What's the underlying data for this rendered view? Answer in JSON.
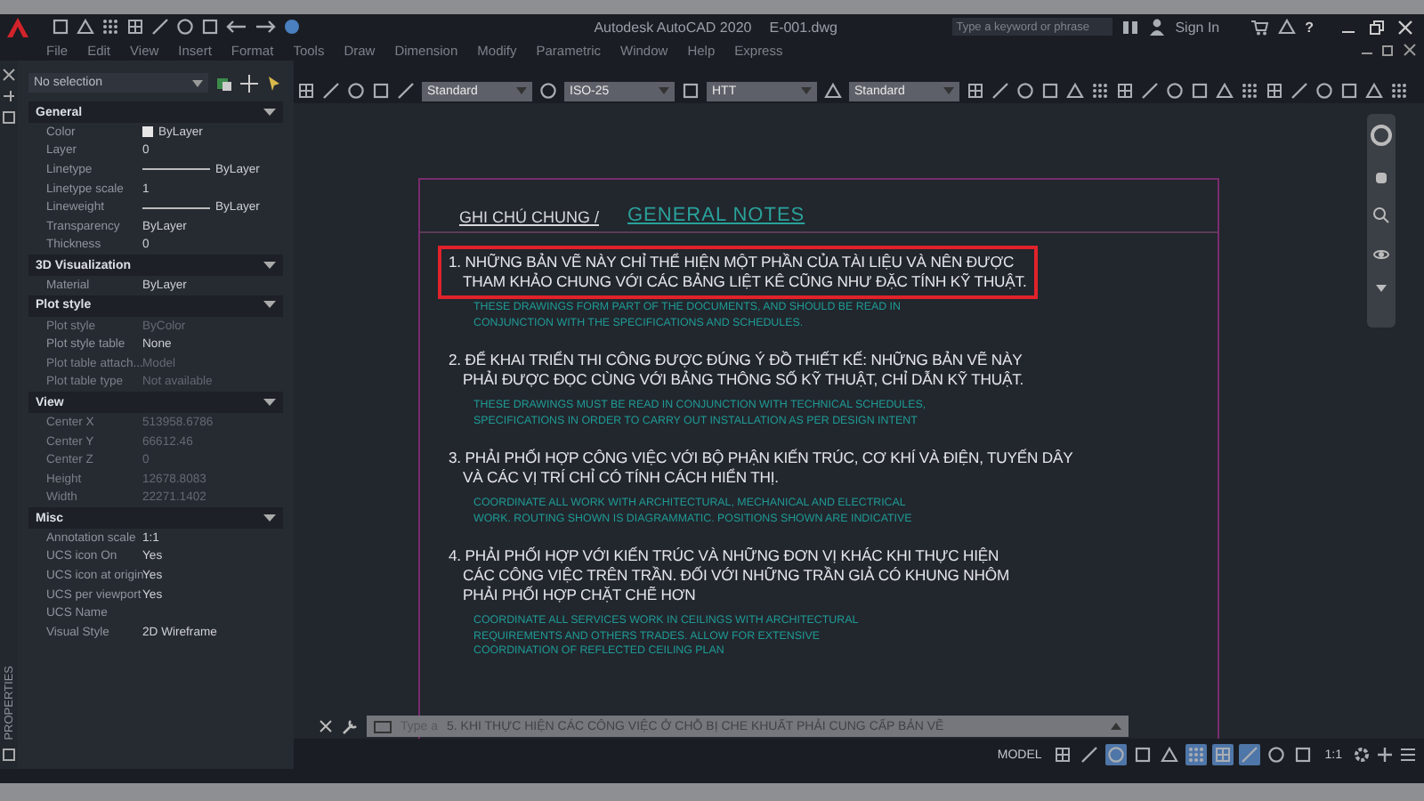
{
  "app": {
    "title": "Autodesk AutoCAD 2020",
    "file": "E-001.dwg",
    "search_placeholder": "Type a keyword or phrase",
    "sign_in": "Sign In",
    "help": "?"
  },
  "menu": [
    "File",
    "Edit",
    "View",
    "Insert",
    "Format",
    "Tools",
    "Draw",
    "Dimension",
    "Modify",
    "Parametric",
    "Window",
    "Help",
    "Express"
  ],
  "toolbar": {
    "dropdowns": [
      "Standard",
      "ISO-25",
      "HTT",
      "Standard"
    ]
  },
  "properties": {
    "selection": "No selection",
    "tab_label": "PROPERTIES",
    "sections": [
      {
        "title": "General",
        "expanded": true,
        "rows": [
          {
            "label": "Color",
            "value": "ByLayer",
            "kind": "swatch",
            "disabled": false
          },
          {
            "label": "Layer",
            "value": "0",
            "kind": "text",
            "disabled": false
          },
          {
            "label": "Linetype",
            "value": "ByLayer",
            "kind": "line",
            "disabled": false
          },
          {
            "label": "Linetype scale",
            "value": "1",
            "kind": "text",
            "disabled": false
          },
          {
            "label": "Lineweight",
            "value": "ByLayer",
            "kind": "line",
            "disabled": false
          },
          {
            "label": "Transparency",
            "value": "ByLayer",
            "kind": "text",
            "disabled": false
          },
          {
            "label": "Thickness",
            "value": "0",
            "kind": "text",
            "disabled": false
          }
        ]
      },
      {
        "title": "3D Visualization",
        "expanded": true,
        "rows": [
          {
            "label": "Material",
            "value": "ByLayer",
            "kind": "text",
            "disabled": false
          }
        ]
      },
      {
        "title": "Plot style",
        "expanded": true,
        "rows": [
          {
            "label": "Plot style",
            "value": "ByColor",
            "kind": "text",
            "disabled": true
          },
          {
            "label": "Plot style table",
            "value": "None",
            "kind": "text",
            "disabled": false
          },
          {
            "label": "Plot table attach...",
            "value": "Model",
            "kind": "text",
            "disabled": true
          },
          {
            "label": "Plot table type",
            "value": "Not available",
            "kind": "text",
            "disabled": true
          }
        ]
      },
      {
        "title": "View",
        "expanded": true,
        "rows": [
          {
            "label": "Center X",
            "value": "513958.6786",
            "kind": "text",
            "disabled": true
          },
          {
            "label": "Center Y",
            "value": "66612.46",
            "kind": "text",
            "disabled": true
          },
          {
            "label": "Center Z",
            "value": "0",
            "kind": "text",
            "disabled": true
          },
          {
            "label": "Height",
            "value": "12678.8083",
            "kind": "text",
            "disabled": true
          },
          {
            "label": "Width",
            "value": "22271.1402",
            "kind": "text",
            "disabled": true
          }
        ]
      },
      {
        "title": "Misc",
        "expanded": true,
        "rows": [
          {
            "label": "Annotation scale",
            "value": "1:1",
            "kind": "text",
            "disabled": false
          },
          {
            "label": "UCS icon On",
            "value": "Yes",
            "kind": "text",
            "disabled": false
          },
          {
            "label": "UCS icon at origin",
            "value": "Yes",
            "kind": "text",
            "disabled": false
          },
          {
            "label": "UCS per viewport",
            "value": "Yes",
            "kind": "text",
            "disabled": false
          },
          {
            "label": "UCS Name",
            "value": "",
            "kind": "text",
            "disabled": false
          },
          {
            "label": "Visual Style",
            "value": "2D Wireframe",
            "kind": "text",
            "disabled": false
          }
        ]
      }
    ]
  },
  "drawing": {
    "heading": "GHI CHÚ CHUNG /",
    "heading_en": "GENERAL NOTES",
    "notes": [
      {
        "highlighted": true,
        "lines_vi": [
          "1. NHỮNG BẢN VẼ NÀY CHỈ THỂ HIỆN MỘT PHẦN CỦA TÀI  LIỆU VÀ NÊN ĐƯỢC",
          "THAM KHẢO CHUNG VỚI CÁC BẢNG LIỆT KÊ CŨNG NHƯ ĐẶC TÍNH KỸ THUẬT."
        ],
        "lines_en": [
          "THESE DRAWINGS FORM PART OF THE DOCUMENTS, AND SHOULD BE READ IN",
          "CONJUNCTION WITH THE SPECIFICATIONS AND SCHEDULES."
        ]
      },
      {
        "highlighted": false,
        "lines_vi": [
          "2. ĐỂ KHAI TRIỂN THI CÔNG ĐƯỢC ĐÚNG Ý ĐỒ THIẾT KẾ: NHỮNG BẢN VẼ NÀY",
          "PHẢI ĐƯỢC ĐỌC CÙNG VỚI BẢNG THÔNG SỐ KỸ THUẬT, CHỈ DẪN KỸ THUẬT."
        ],
        "lines_en": [
          "THESE DRAWINGS MUST BE READ IN CONJUNCTION WITH TECHNICAL SCHEDULES,",
          "SPECIFICATIONS IN ORDER TO CARRY OUT INSTALLATION AS PER DESIGN INTENT"
        ]
      },
      {
        "highlighted": false,
        "lines_vi": [
          "3. PHẢI PHỐI HỢP CÔNG VIỆC VỚI BỘ PHẬN KIẾN TRÚC, CƠ KHÍ VÀ ĐIỆN, TUYẾN DÂY",
          "VÀ CÁC VỊ TRÍ CHỈ CÓ TÍNH CÁCH HIỂN THỊ."
        ],
        "lines_en": [
          "COORDINATE ALL WORK WITH ARCHITECTURAL, MECHANICAL AND ELECTRICAL",
          "WORK. ROUTING SHOWN IS DIAGRAMMATIC. POSITIONS SHOWN ARE INDICATIVE"
        ]
      },
      {
        "highlighted": false,
        "lines_vi": [
          "4. PHẢI PHỐI HỢP VỚI KIẾN TRÚC VÀ NHỮNG ĐƠN VỊ KHÁC KHI THỰC HIỆN",
          "CÁC CÔNG VIỆC TRÊN TRẦN. ĐỐI VỚI NHỮNG TRẦN GIẢ CÓ KHUNG NHÔM",
          "PHẢI PHỐI HỢP CHẶT CHẼ HƠN"
        ],
        "lines_en": [
          "COORDINATE ALL SERVICES WORK IN CEILINGS WITH ARCHITECTURAL",
          "REQUIREMENTS AND OTHERS TRADES. ALLOW FOR EXTENSIVE",
          "COORDINATION OF REFLECTED CEILING PLAN"
        ]
      }
    ]
  },
  "command_line": {
    "placeholder": "Type a",
    "note_behind": "5. KHI THỰC HIỆN CÁC CÔNG VIỆC Ở CHỖ BỊ CHE KHUẤT PHẢI CUNG CẤP BẢN VẼ"
  },
  "status_bar": {
    "model": "MODEL",
    "scale": "1:1",
    "toggles": [
      {
        "on": false
      },
      {
        "on": false
      },
      {
        "on": true
      },
      {
        "on": false
      },
      {
        "on": false
      },
      {
        "on": true
      },
      {
        "on": true
      },
      {
        "on": true
      },
      {
        "on": false
      },
      {
        "on": false
      }
    ]
  }
}
